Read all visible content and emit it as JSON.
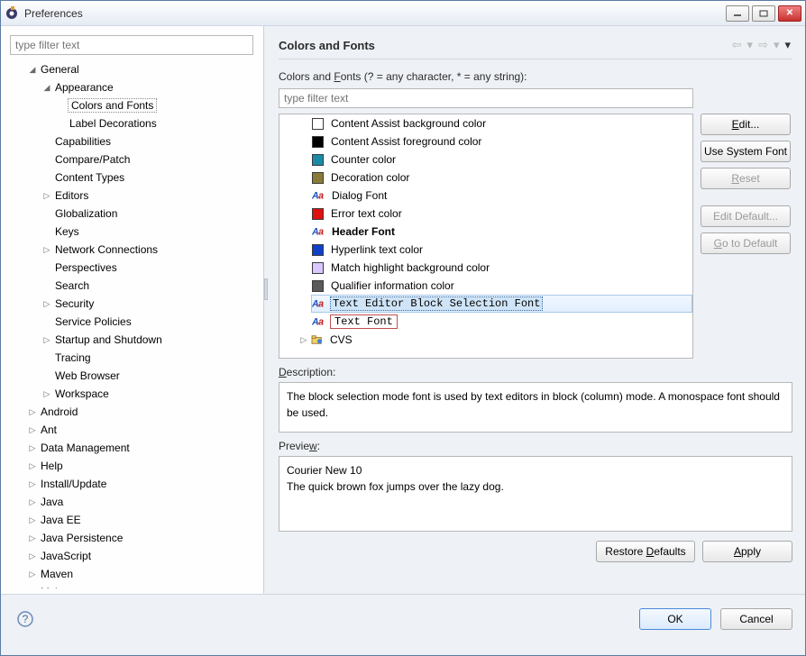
{
  "window": {
    "title": "Preferences"
  },
  "filter_placeholder": "type filter text",
  "tree": [
    {
      "l": "General",
      "d": 0,
      "e": true
    },
    {
      "l": "Appearance",
      "d": 1,
      "e": true
    },
    {
      "l": "Colors and Fonts",
      "d": 2,
      "sel": true
    },
    {
      "l": "Label Decorations",
      "d": 2
    },
    {
      "l": "Capabilities",
      "d": 1
    },
    {
      "l": "Compare/Patch",
      "d": 1
    },
    {
      "l": "Content Types",
      "d": 1
    },
    {
      "l": "Editors",
      "d": 1,
      "c": true
    },
    {
      "l": "Globalization",
      "d": 1
    },
    {
      "l": "Keys",
      "d": 1
    },
    {
      "l": "Network Connections",
      "d": 1,
      "c": true
    },
    {
      "l": "Perspectives",
      "d": 1
    },
    {
      "l": "Search",
      "d": 1
    },
    {
      "l": "Security",
      "d": 1,
      "c": true
    },
    {
      "l": "Service Policies",
      "d": 1
    },
    {
      "l": "Startup and Shutdown",
      "d": 1,
      "c": true
    },
    {
      "l": "Tracing",
      "d": 1
    },
    {
      "l": "Web Browser",
      "d": 1
    },
    {
      "l": "Workspace",
      "d": 1,
      "c": true
    },
    {
      "l": "Android",
      "d": 0,
      "c": true
    },
    {
      "l": "Ant",
      "d": 0,
      "c": true
    },
    {
      "l": "Data Management",
      "d": 0,
      "c": true
    },
    {
      "l": "Help",
      "d": 0,
      "c": true
    },
    {
      "l": "Install/Update",
      "d": 0,
      "c": true
    },
    {
      "l": "Java",
      "d": 0,
      "c": true
    },
    {
      "l": "Java EE",
      "d": 0,
      "c": true
    },
    {
      "l": "Java Persistence",
      "d": 0,
      "c": true
    },
    {
      "l": "JavaScript",
      "d": 0,
      "c": true
    },
    {
      "l": "Maven",
      "d": 0,
      "c": true
    },
    {
      "l": "Mylyn",
      "d": 0,
      "c": true
    }
  ],
  "page_title": "Colors and Fonts",
  "match_text_a": "Colors and ",
  "match_text_b": "F",
  "match_text_c": "onts (? = any character, * = any string):",
  "list_filter_placeholder": "type filter text",
  "items": [
    {
      "t": "color",
      "c": "#ffffff",
      "l": "Content Assist background color"
    },
    {
      "t": "color",
      "c": "#000000",
      "l": "Content Assist foreground color"
    },
    {
      "t": "color",
      "c": "#1a8aa6",
      "l": "Counter color"
    },
    {
      "t": "color",
      "c": "#8a7a3a",
      "l": "Decoration color"
    },
    {
      "t": "font",
      "l": "Dialog Font"
    },
    {
      "t": "color",
      "c": "#e01010",
      "l": "Error text color"
    },
    {
      "t": "font",
      "l": "Header Font",
      "b": true
    },
    {
      "t": "color",
      "c": "#1040c8",
      "l": "Hyperlink text color"
    },
    {
      "t": "color",
      "c": "#d8c8ff",
      "l": "Match highlight background color"
    },
    {
      "t": "color",
      "c": "#5a5a5a",
      "l": "Qualifier information color"
    },
    {
      "t": "font",
      "l": "Text Editor Block Selection Font",
      "sel": true
    },
    {
      "t": "font",
      "l": "Text Font",
      "hl": true
    },
    {
      "t": "cvs",
      "l": "CVS"
    }
  ],
  "buttons": {
    "edit": "Edit...",
    "use_system": "Use System Font",
    "reset": "Reset",
    "edit_default": "Edit Default...",
    "go_default": "Go to Default"
  },
  "desc_label_a": "D",
  "desc_label_b": "escription:",
  "description": "The block selection mode font is used by text editors in block (column) mode. A monospace font should be used.",
  "prev_label_a": "Previe",
  "prev_label_b": "w",
  "prev_label_c": ":",
  "preview_line1": "Courier New 10",
  "preview_line2": "The quick brown fox jumps over the lazy dog.",
  "restore": "Restore Defaults",
  "apply": "Apply",
  "ok": "OK",
  "cancel": "Cancel"
}
